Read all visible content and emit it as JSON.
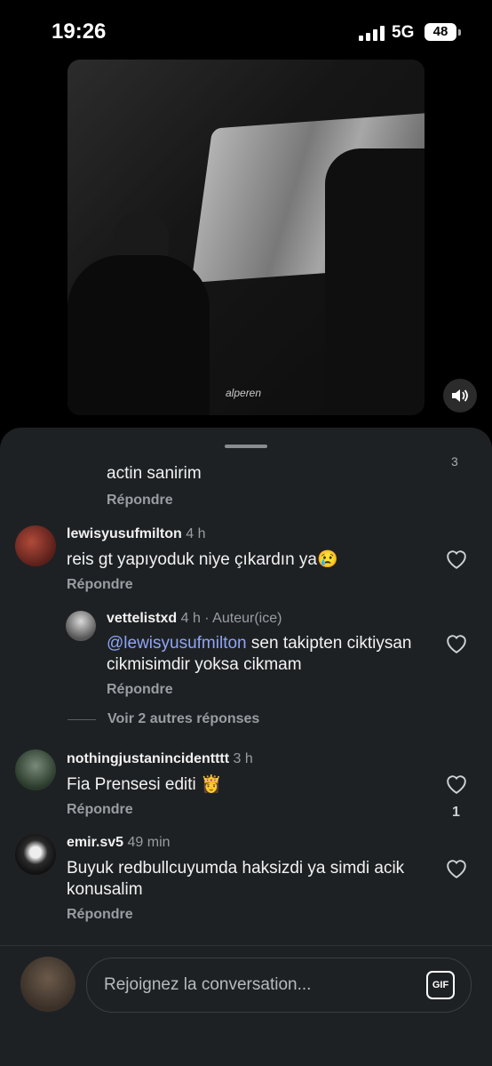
{
  "status_bar": {
    "time": "19:26",
    "network": "5G",
    "battery": "48"
  },
  "video": {
    "watermark": "alperen",
    "mute_icon": "speaker-icon"
  },
  "comments": [
    {
      "id": "c0",
      "body": "actin sanirim",
      "reply_label": "Répondre"
    },
    {
      "id": "c1",
      "username": "lewisyusufmilton",
      "meta": "4 h",
      "body": "reis gt yapıyoduk niye çıkardın ya😢",
      "reply_label": "Répondre",
      "likes": ""
    },
    {
      "id": "c2",
      "username": "vettelistxd",
      "meta": "4 h · Auteur(ice)",
      "mention": "@lewisyusufmilton",
      "body": " sen takipten ciktiysan cikmisimdir yoksa cikmam",
      "reply_label": "Répondre"
    },
    {
      "id": "c3",
      "username": "nothingjustanincidentttt",
      "meta": "3 h",
      "body": "Fia Prensesi editi 👸",
      "reply_label": "Répondre",
      "likes": "1"
    },
    {
      "id": "c4",
      "username": "emir.sv5",
      "meta": "49 min",
      "body": "Buyuk redbullcuyumda haksizdi ya simdi acik konusalim",
      "reply_label": "Répondre"
    }
  ],
  "more_replies": "Voir 2 autres réponses",
  "composer": {
    "placeholder": "Rejoignez la conversation...",
    "gif_label": "GIF"
  }
}
